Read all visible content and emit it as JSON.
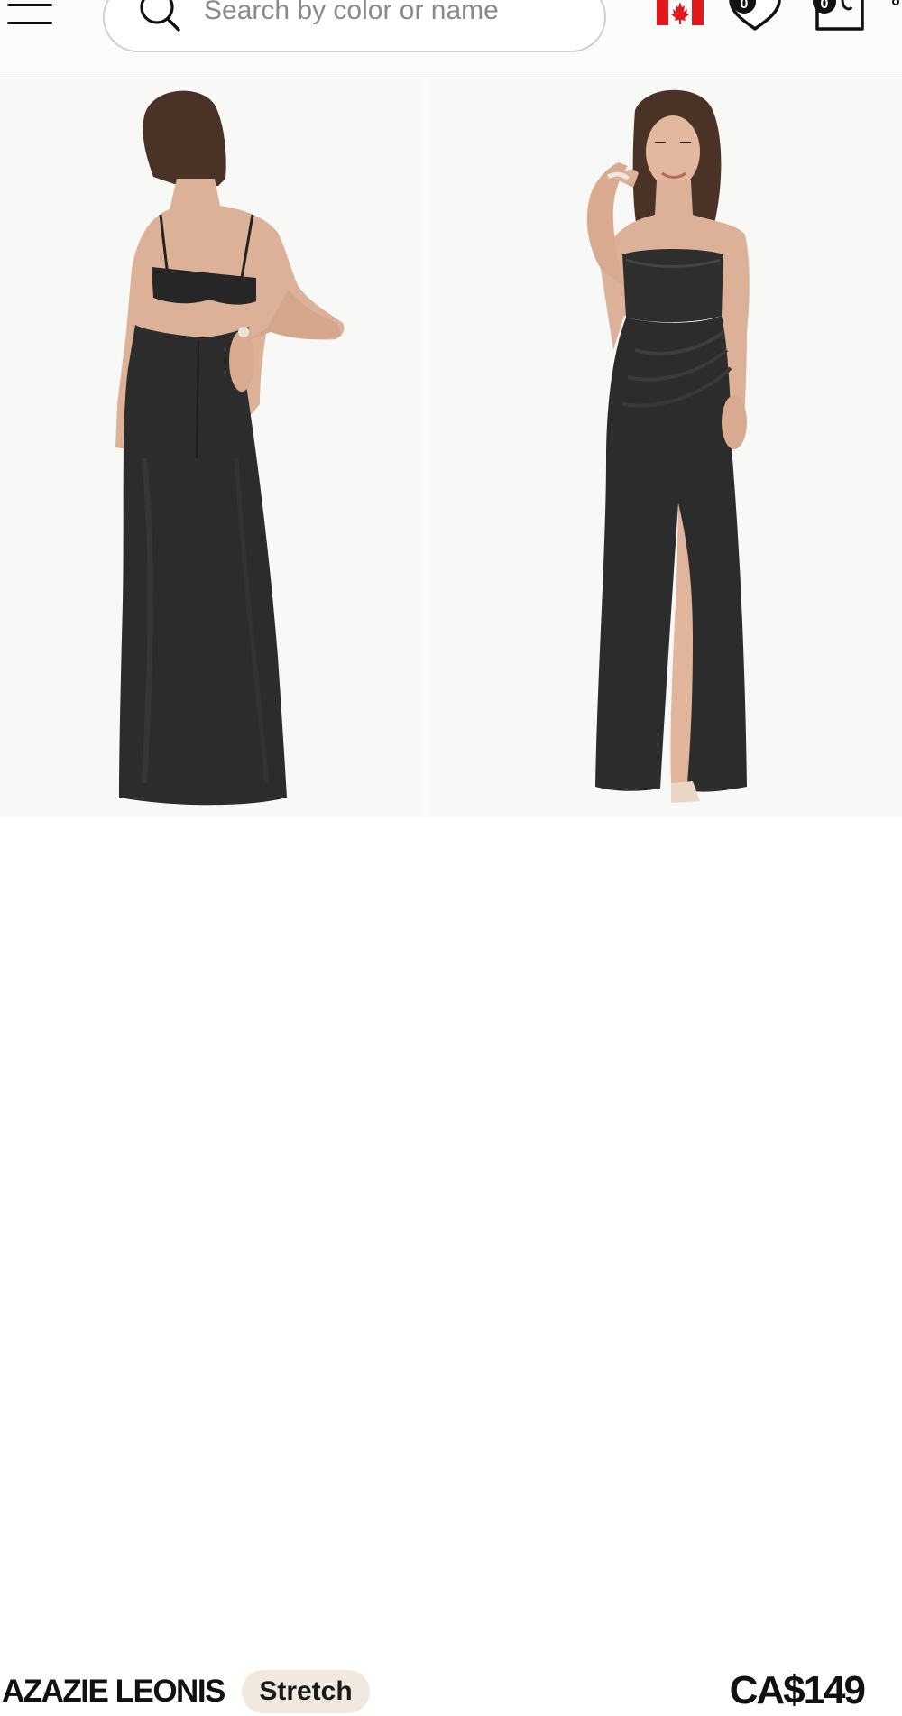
{
  "header": {
    "search": {
      "placeholder": "Search by color or name",
      "value": ""
    },
    "wishlist_count": "0",
    "bag_count": "0"
  },
  "gallery": {
    "images": [
      {
        "view": "back",
        "dress_color": "#2c2c2c"
      },
      {
        "view": "front",
        "dress_color": "#2c2c2c"
      }
    ]
  },
  "product": {
    "name": "AZAZIE LEONIS",
    "badge": "Stretch",
    "price": "CA$149"
  },
  "colors": {
    "badge_bg": "#f1e9df",
    "flag_red": "#e0191f",
    "text": "#111111"
  },
  "icons": {
    "menu": "hamburger-icon",
    "search": "magnifier-icon",
    "flag": "canada-flag-icon",
    "wishlist": "heart-icon",
    "bag": "shopping-bag-icon"
  }
}
